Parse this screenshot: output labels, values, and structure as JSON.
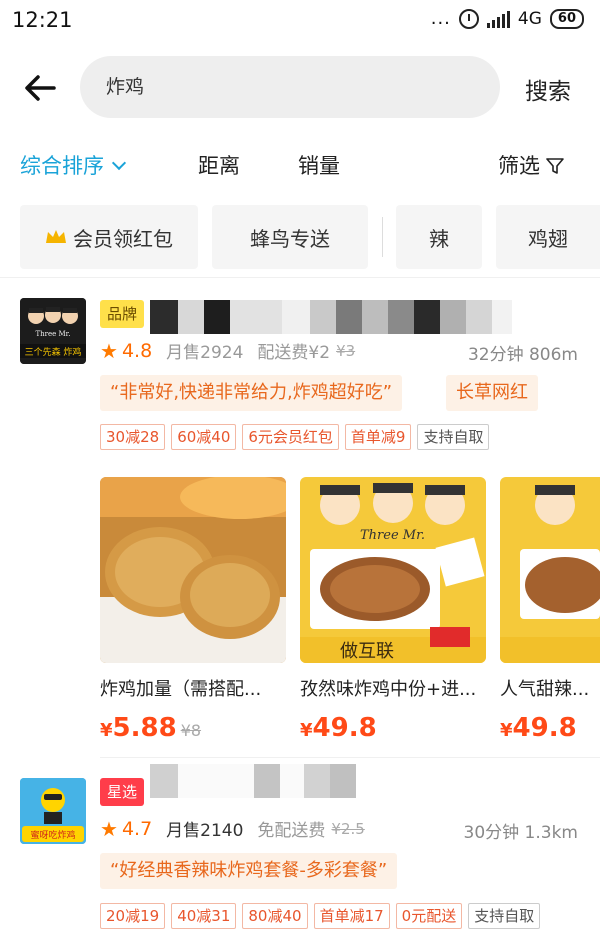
{
  "status_bar": {
    "time": "12:21",
    "dots": "...",
    "network": "4G",
    "battery": "60"
  },
  "header": {
    "search_value": "炸鸡",
    "search_button": "搜索"
  },
  "sort_bar": {
    "items": [
      "综合排序",
      "距离",
      "销量"
    ],
    "filter_label": "筛选"
  },
  "chips": [
    "会员领红包",
    "蜂鸟专送",
    "辣",
    "鸡翅"
  ],
  "shops": [
    {
      "badge": "品牌",
      "rating": "4.8",
      "monthly_sales": "月售2924",
      "delivery_fee": "配送费¥2",
      "delivery_fee_old": "¥3",
      "time_distance": "32分钟 806m",
      "quote": "“非常好,快递非常给力,炸鸡超好吃”",
      "tag": "长草网红",
      "promotions": [
        "30减28",
        "60减40",
        "6元会员红包",
        "首单减9",
        "支持自取"
      ],
      "products": [
        {
          "name": "炸鸡加量（需搭配...",
          "currency": "¥",
          "price": "5.88",
          "old_price": "¥8"
        },
        {
          "name": "孜然味炸鸡中份+进...",
          "currency": "¥",
          "price": "49.8",
          "old_price": ""
        },
        {
          "name": "人气甜辣...",
          "currency": "¥",
          "price": "49.8",
          "old_price": ""
        }
      ],
      "logo_text": "三个先森 炸鸡",
      "logo_sub": "Three Mr.",
      "box_text": "Three Mr.",
      "box_slogan": "做互联"
    },
    {
      "badge": "星选",
      "rating": "4.7",
      "monthly_sales": "月售2140",
      "delivery_fee": "免配送费",
      "delivery_fee_old": "¥2.5",
      "time_distance": "30分钟 1.3km",
      "quote": "“好经典香辣味炸鸡套餐-多彩套餐”",
      "promotions": [
        "20减19",
        "40减31",
        "80减40",
        "首单减17",
        "0元配送",
        "支持自取"
      ],
      "logo_text": "蜜呀吃炸鸡"
    }
  ],
  "colors": {
    "accent": "#1aa3d8",
    "price": "#ff4a17",
    "brand_badge": "#ffe04a",
    "star_badge": "#ff3d4a"
  }
}
